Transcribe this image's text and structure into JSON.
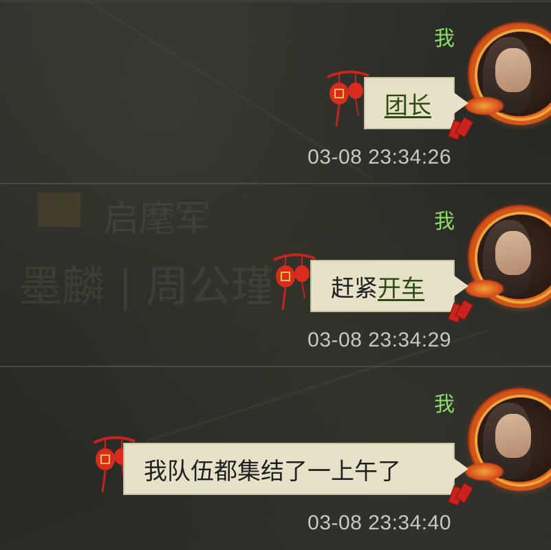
{
  "chat": {
    "messages": [
      {
        "sender": "我",
        "text_plain": "",
        "text_link": "团长",
        "timestamp": "03-08 23:34:26"
      },
      {
        "sender": "我",
        "text_plain": "赶紧",
        "text_link": "开车",
        "timestamp": "03-08 23:34:29"
      },
      {
        "sender": "我",
        "text_plain": "我队伍都集结了一上午了",
        "text_link": "",
        "timestamp": "03-08 23:34:40"
      }
    ]
  },
  "background": {
    "faded_text_1": "启麾军",
    "faded_text_2": "墨麟 | 周公瑾"
  },
  "colors": {
    "sender_name": "#8ddc6a",
    "bubble_fill": "#e6e2c8",
    "link_text": "#2f4a14",
    "timestamp": "#c9c9c4",
    "divider": "#4a4a46"
  },
  "icons": {
    "avatar": "player-avatar-icon",
    "decoration": "red-lantern-icon",
    "envelope": "red-envelope-icon"
  }
}
